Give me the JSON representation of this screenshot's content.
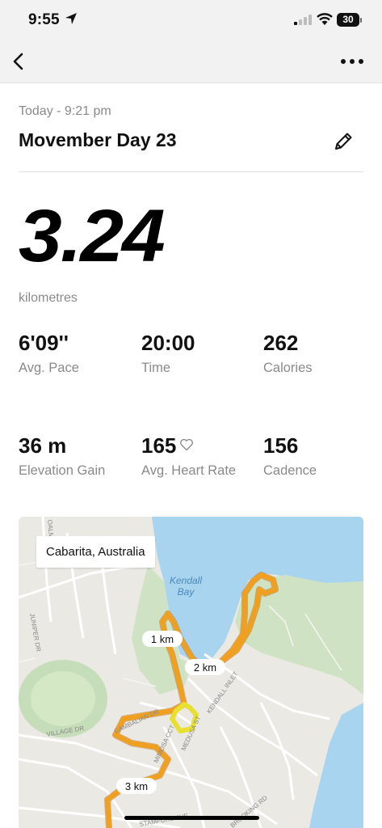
{
  "status_bar": {
    "time": "9:55",
    "battery": "30",
    "icons": [
      "location-arrow-icon",
      "signal-icon",
      "wifi-icon",
      "battery-icon"
    ]
  },
  "nav": {
    "back_icon": "chevron-left-icon",
    "more_icon": "more-horizontal-icon"
  },
  "activity": {
    "date": "Today - 9:21 pm",
    "title": "Movember Day 23",
    "edit_icon": "pencil-icon",
    "distance": "3.24",
    "distance_unit": "kilometres"
  },
  "stats": [
    {
      "value": "6'09''",
      "label": "Avg. Pace"
    },
    {
      "value": "20:00",
      "label": "Time"
    },
    {
      "value": "262",
      "label": "Calories"
    },
    {
      "value": "36 m",
      "label": "Elevation Gain"
    },
    {
      "value": "165",
      "label": "Avg. Heart Rate",
      "icon": "heart-outline-icon"
    },
    {
      "value": "156",
      "label": "Cadence"
    }
  ],
  "map": {
    "location": "Cabarita, Australia",
    "water_label_line1": "Kendall",
    "water_label_line2": "Bay",
    "km_markers": [
      "1 km",
      "2 km",
      "3 km"
    ],
    "streets": [
      "JUNIPER DR",
      "VILLAGE DR",
      "MIMOSA CCT",
      "KENDALL INLET",
      "MEDUSA ST",
      "CAMBALIAN DR",
      "STAMFORD AVE",
      "BROOKING RD",
      "OALMI..."
    ],
    "colors": {
      "water": "#a8d4f0",
      "park": "#cfe3c4",
      "route_orange": "#f0a020",
      "route_yellow": "#e8e030"
    }
  }
}
